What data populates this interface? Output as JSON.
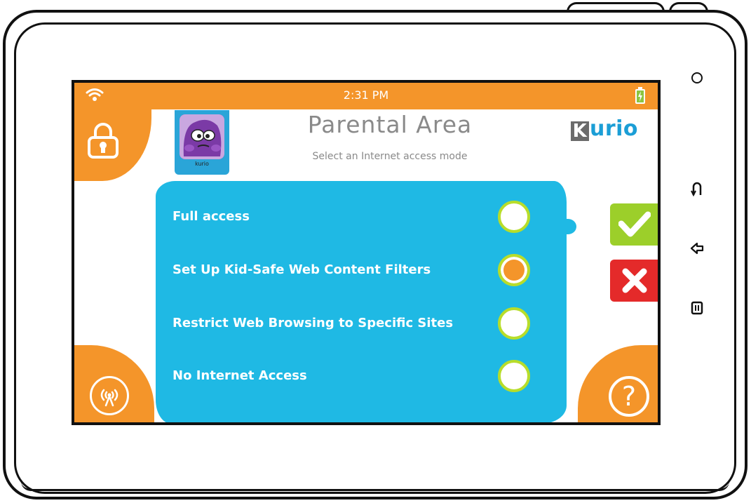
{
  "status_bar": {
    "time": "2:31 PM",
    "wifi_icon": "wifi-icon",
    "battery_icon": "battery-charging-icon"
  },
  "header": {
    "title": "Parental Area",
    "subtitle": "Select an Internet access mode",
    "logo_k": "K",
    "logo_rest": "urio"
  },
  "profile": {
    "name": "kurio"
  },
  "options": [
    {
      "label": "Full access",
      "selected": false
    },
    {
      "label": "Set Up Kid-Safe Web Content Filters",
      "selected": true
    },
    {
      "label": "Restrict Web Browsing to Specific Sites",
      "selected": false
    },
    {
      "label": "No Internet Access",
      "selected": false
    }
  ],
  "actions": {
    "confirm_icon": "checkmark-icon",
    "cancel_icon": "close-icon"
  },
  "corners": {
    "lock_icon": "lock-icon",
    "network_icon": "broadcast-icon",
    "help_icon": "help-icon",
    "help_glyph": "?"
  },
  "hardware_buttons": [
    "power-icon",
    "home-icon",
    "back-icon",
    "menu-icon"
  ],
  "colors": {
    "accent_orange": "#f4952a",
    "panel_blue": "#1fb9e4",
    "radio_green": "#b8dd2a",
    "ok_green": "#9ccf2a",
    "cancel_red": "#e42a2a"
  }
}
